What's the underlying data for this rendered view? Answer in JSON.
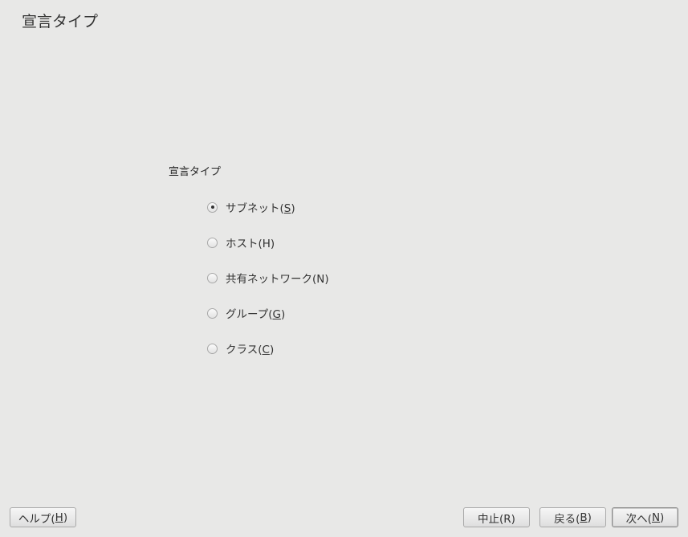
{
  "title": "宣言タイプ",
  "group_label": "宣言タイプ",
  "options": [
    {
      "pre": "サブネット(",
      "key": "S",
      "post": ")",
      "selected": true
    },
    {
      "pre": "ホスト(H)",
      "key": "",
      "post": "",
      "selected": false
    },
    {
      "pre": "共有ネットワーク(N)",
      "key": "",
      "post": "",
      "selected": false
    },
    {
      "pre": "グループ(",
      "key": "G",
      "post": ")",
      "selected": false
    },
    {
      "pre": "クラス(",
      "key": "C",
      "post": ")",
      "selected": false
    }
  ],
  "buttons": {
    "help": {
      "pre": "ヘルプ(",
      "key": "H",
      "post": ")"
    },
    "abort": {
      "pre": "中止(R)",
      "key": "",
      "post": ""
    },
    "back": {
      "pre": "戻る(",
      "key": "B",
      "post": ")"
    },
    "next": {
      "pre": "次へ(",
      "key": "N",
      "post": ")"
    }
  }
}
